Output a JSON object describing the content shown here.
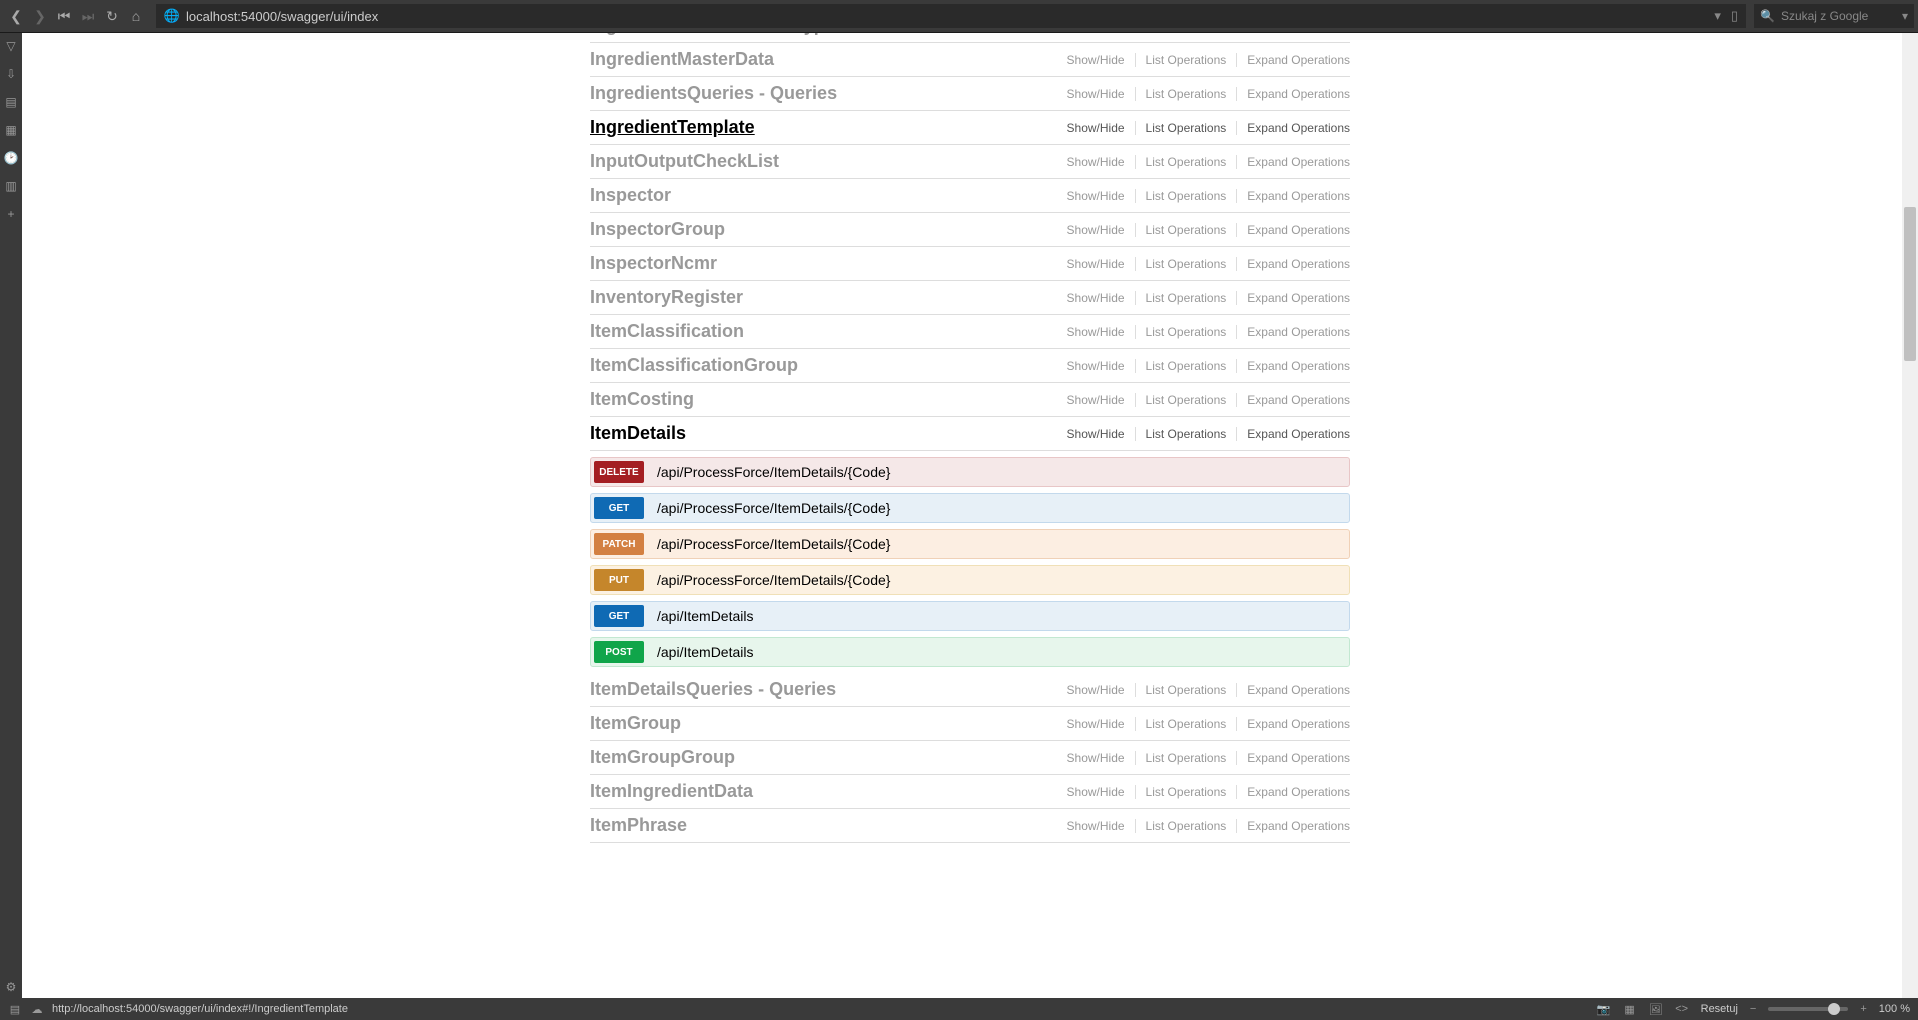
{
  "browser": {
    "url": "localhost:54000/swagger/ui/index",
    "search_placeholder": "Szukaj z Google"
  },
  "labels": {
    "show_hide": "Show/Hide",
    "list_ops": "List Operations",
    "expand_ops": "Expand Operations",
    "reset": "Resetuj",
    "zoom_level": "100 %"
  },
  "status_url": "http://localhost:54000/swagger/ui/index#!/IngredientTemplate",
  "resources": [
    {
      "name": "IngredientClassificationType",
      "active": false,
      "cut": true
    },
    {
      "name": "IngredientMasterData",
      "active": false
    },
    {
      "name": "IngredientsQueries - Queries",
      "active": false
    },
    {
      "name": "IngredientTemplate",
      "active": true,
      "underline": true
    },
    {
      "name": "InputOutputCheckList",
      "active": false
    },
    {
      "name": "Inspector",
      "active": false
    },
    {
      "name": "InspectorGroup",
      "active": false
    },
    {
      "name": "InspectorNcmr",
      "active": false
    },
    {
      "name": "InventoryRegister",
      "active": false
    },
    {
      "name": "ItemClassification",
      "active": false
    },
    {
      "name": "ItemClassificationGroup",
      "active": false
    },
    {
      "name": "ItemCosting",
      "active": false
    },
    {
      "name": "ItemDetails",
      "active": true,
      "expanded": true,
      "operations": [
        {
          "method": "DELETE",
          "class": "op-delete",
          "path": "/api/ProcessForce/ItemDetails/{Code}"
        },
        {
          "method": "GET",
          "class": "op-get",
          "path": "/api/ProcessForce/ItemDetails/{Code}"
        },
        {
          "method": "PATCH",
          "class": "op-patch",
          "path": "/api/ProcessForce/ItemDetails/{Code}"
        },
        {
          "method": "PUT",
          "class": "op-put",
          "path": "/api/ProcessForce/ItemDetails/{Code}"
        },
        {
          "method": "GET",
          "class": "op-get",
          "path": "/api/ItemDetails"
        },
        {
          "method": "POST",
          "class": "op-post",
          "path": "/api/ItemDetails"
        }
      ]
    },
    {
      "name": "ItemDetailsQueries - Queries",
      "active": false
    },
    {
      "name": "ItemGroup",
      "active": false
    },
    {
      "name": "ItemGroupGroup",
      "active": false
    },
    {
      "name": "ItemIngredientData",
      "active": false
    },
    {
      "name": "ItemPhrase",
      "active": false
    }
  ]
}
